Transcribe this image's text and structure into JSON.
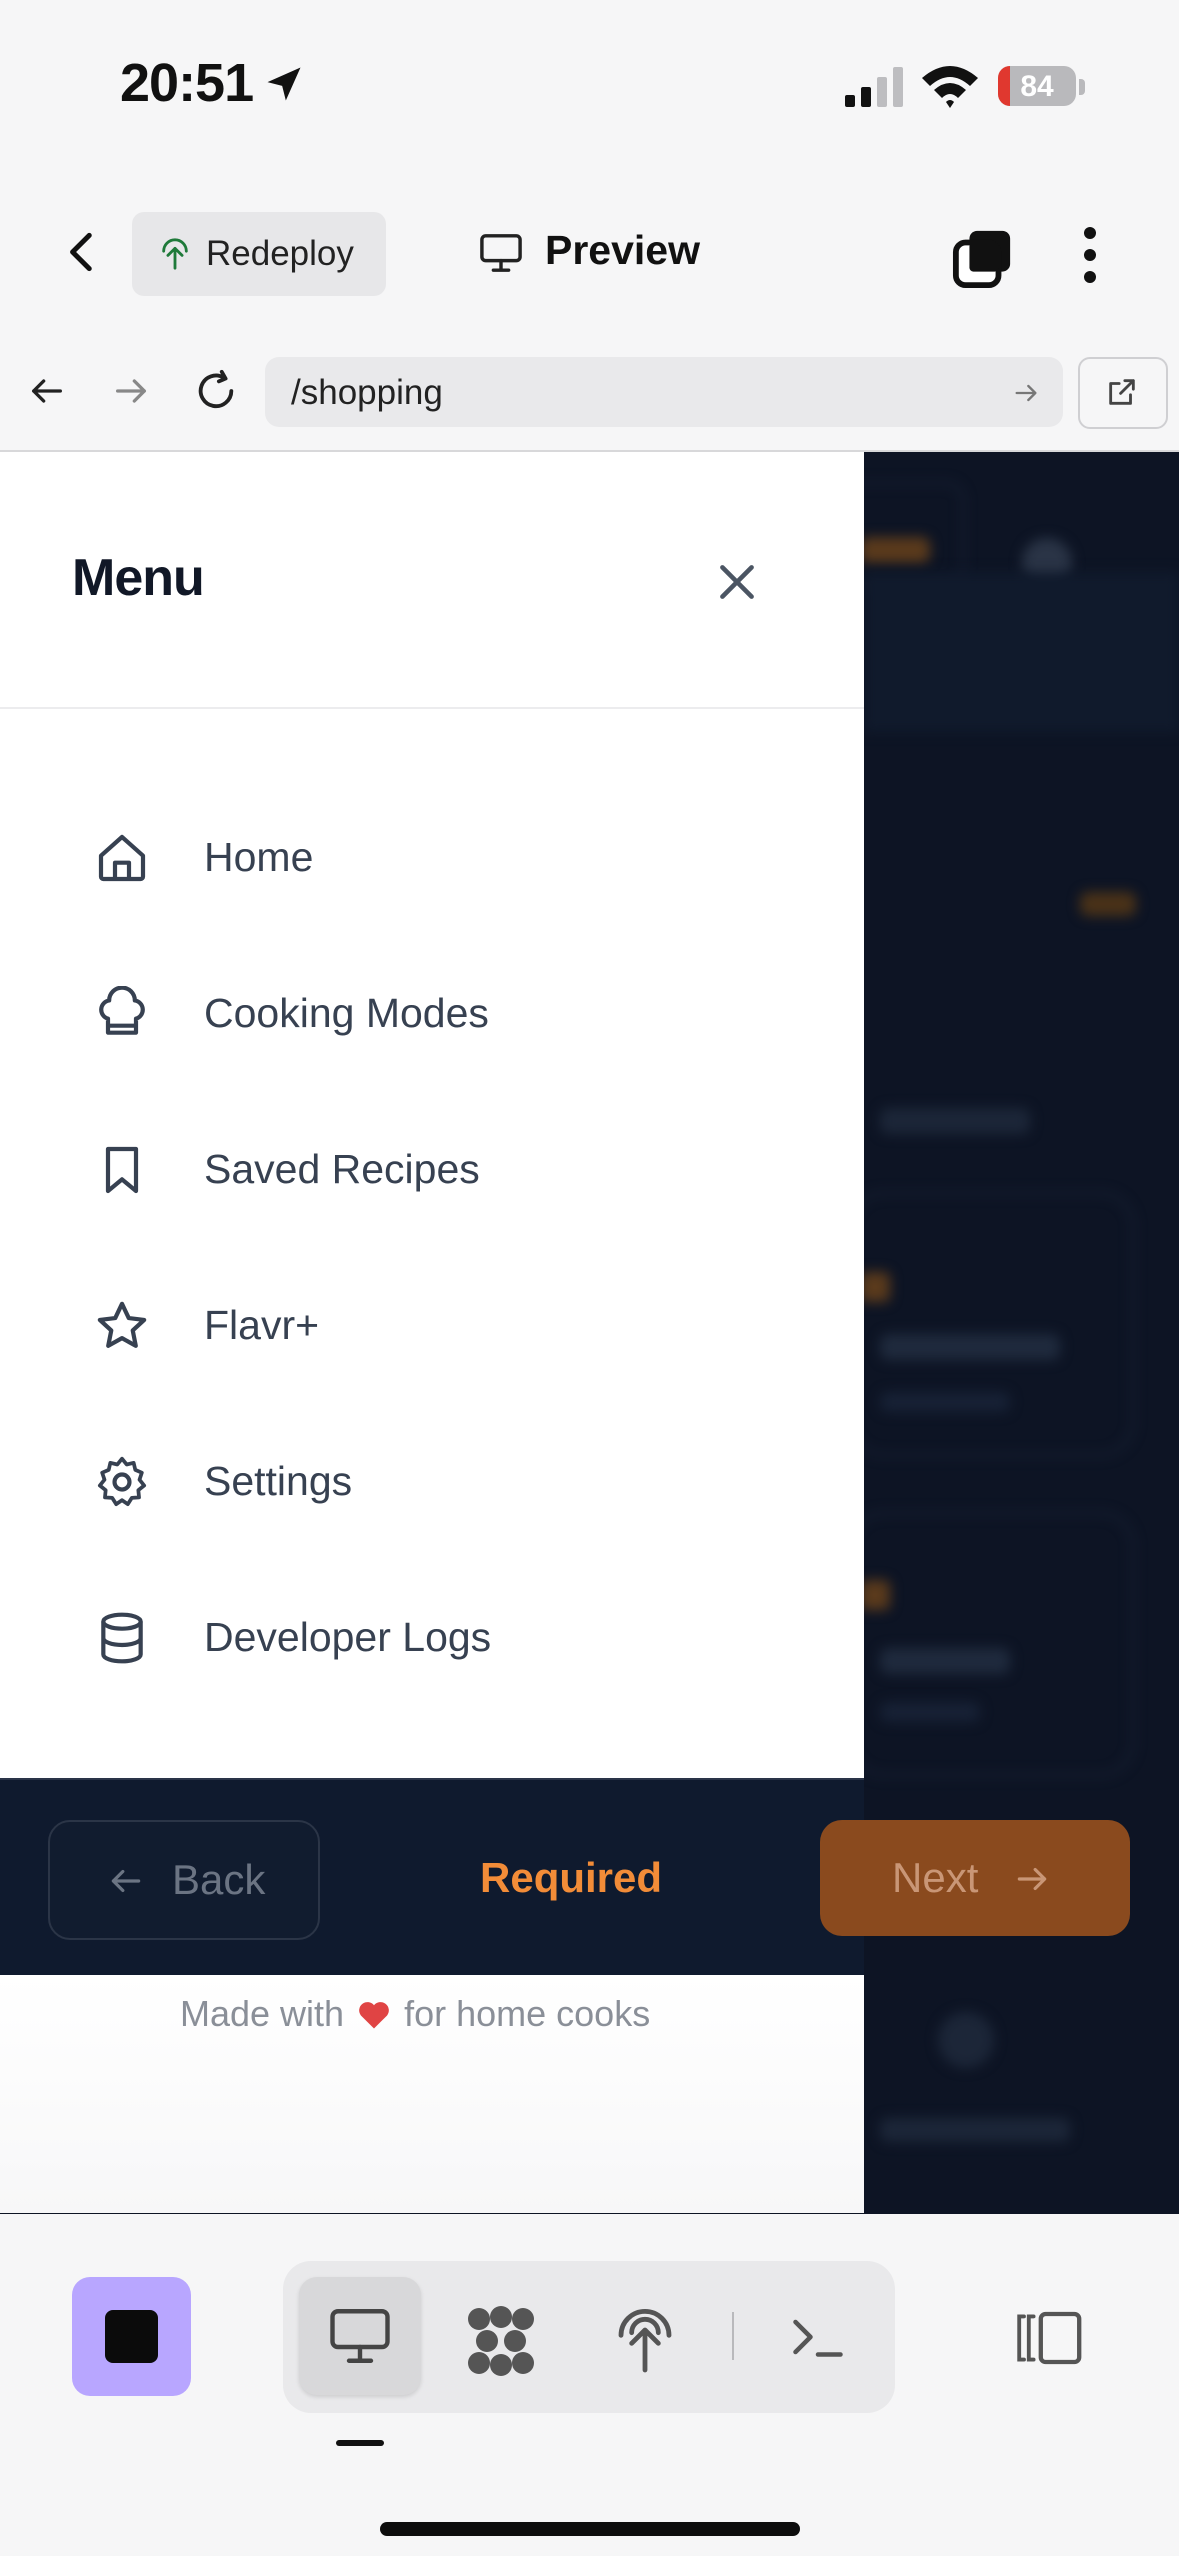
{
  "status_bar": {
    "time": "20:51",
    "battery": "84",
    "battery_level": 0.16,
    "battery_color": "#e0382f"
  },
  "header": {
    "redeploy_label": "Redeploy",
    "preview_label": "Preview"
  },
  "browser": {
    "url": "/shopping"
  },
  "drawer": {
    "title": "Menu",
    "items": [
      {
        "label": "Home",
        "icon": "home-icon"
      },
      {
        "label": "Cooking Modes",
        "icon": "chef-hat-icon"
      },
      {
        "label": "Saved Recipes",
        "icon": "bookmark-icon"
      },
      {
        "label": "Flavr+",
        "icon": "star-icon"
      },
      {
        "label": "Settings",
        "icon": "gear-icon"
      },
      {
        "label": "Developer Logs",
        "icon": "database-icon"
      }
    ]
  },
  "footer_nav": {
    "back_label": "Back",
    "required_label": "Required",
    "next_label": "Next"
  },
  "made_with": {
    "prefix": "Made with",
    "suffix": "for home cooks"
  },
  "colors": {
    "accent": "#f28c38",
    "dark_bg": "#0d1424",
    "stop_button": "#b8a6ff"
  }
}
